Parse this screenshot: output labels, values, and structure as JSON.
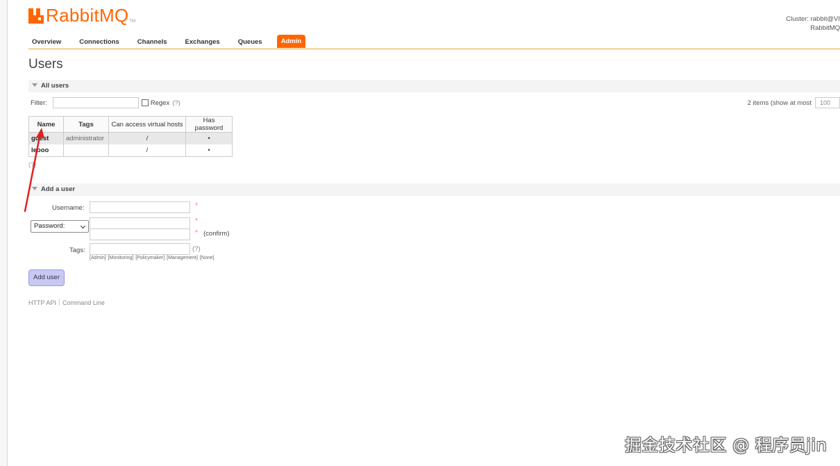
{
  "header": {
    "logo_word_rabbit": "Rabbit",
    "logo_word_mq": "MQ",
    "logo_tm": "TM",
    "cluster_line1": "Cluster: rabbit@VI",
    "cluster_line2": "RabbitMQ"
  },
  "tabs": [
    "Overview",
    "Connections",
    "Channels",
    "Exchanges",
    "Queues",
    "Admin"
  ],
  "active_tab": "Admin",
  "page_title": "Users",
  "all_users": {
    "section_title": "All users",
    "filter_label": "Filter:",
    "regex_label": "Regex",
    "help": "(?)",
    "items_info": "2 items (show at most",
    "max_value": "100",
    "columns": [
      "Name",
      "Tags",
      "Can access virtual hosts",
      "Has password"
    ],
    "rows": [
      {
        "name": "guest",
        "tags": "administrator",
        "vhosts": "/",
        "has_password": "•"
      },
      {
        "name": "le​ooo",
        "tags": "",
        "vhosts": "/",
        "has_password": "•"
      }
    ],
    "under_help": "(?)"
  },
  "add_user": {
    "section_title": "Add a user",
    "username_label": "Username:",
    "password_select": "Password:",
    "required_mark": "*",
    "confirm_label": "(confirm)",
    "tags_label": "Tags:",
    "tags_help": "(?)",
    "tag_links": "[Admin] [Monitoring] [Policymaker] [Management] [None]",
    "button_label": "Add user"
  },
  "footer": {
    "http_api": "HTTP API",
    "command_line": "Command Line"
  },
  "watermark": "掘金技术社区 @ 程序员jin",
  "colors": {
    "accent": "#ff6600",
    "annotation_arrow": "#e02020",
    "button_bg": "#c8c8f4"
  }
}
